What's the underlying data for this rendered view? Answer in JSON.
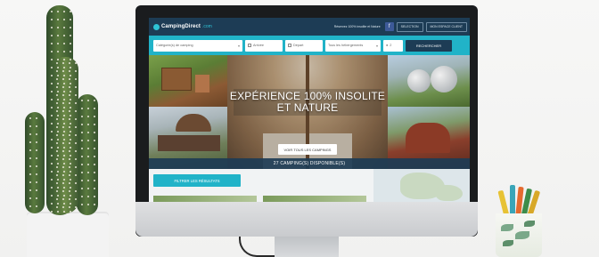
{
  "site": {
    "logo_name": "CampingDirect",
    "logo_tld": ".com",
    "header_info": "Réservez 100% insolite et Nature",
    "facebook_label": "f",
    "header_btn_1": "SELECTION",
    "header_btn_2": "MON ESPACE CLIENT"
  },
  "search": {
    "accommodation_type": "Catégorie(s) de camping",
    "arrival": "Arrivée",
    "departure": "Départ",
    "lodging": "Tous les hébergements",
    "guests": "2",
    "search_button": "RECHERCHER"
  },
  "hero": {
    "title_line_1": "EXPÉRIENCE 100% INSOLITE",
    "title_line_2": "ET NATURE",
    "cta": "VOIR TOUS LES CAMPINGS"
  },
  "results": {
    "available": "27 CAMPING(S) DISPONIBLE(S)",
    "filter_button": "FILTRER LES RÉSULTATS"
  },
  "colors": {
    "header_navy": "#1d3c55",
    "accent_teal": "#21b3c8"
  },
  "icons": [
    "calendar-icon",
    "person-icon",
    "chevron-down-icon",
    "facebook-icon"
  ]
}
